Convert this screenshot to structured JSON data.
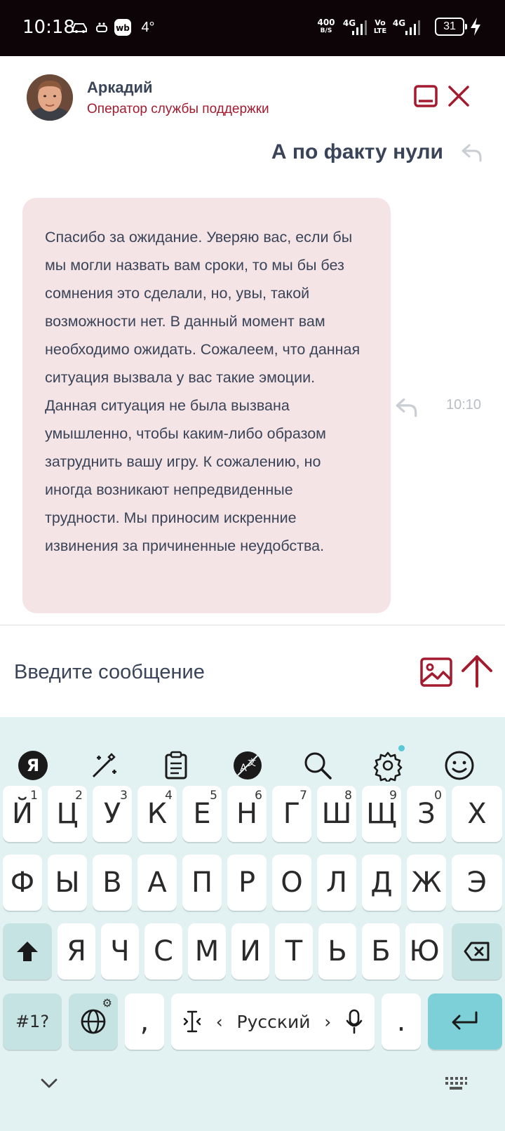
{
  "status_bar": {
    "time": "10:18",
    "temp": "4°",
    "speed_value": "400",
    "speed_unit": "B/S",
    "net1": "4G",
    "net2_top": "Vo",
    "net2_bottom": "LTE",
    "net3": "4G",
    "battery": "31"
  },
  "header": {
    "operator_name": "Аркадий",
    "operator_role": "Оператор службы поддержки"
  },
  "reply_preview": {
    "text": "А по факту нули"
  },
  "message": {
    "text": "Спасибо за ожидание. Уверяю вас, если бы мы могли назвать вам сроки, то мы бы без сомнения это сделали, но, увы, такой возможности нет. В данный момент вам необходимо ожидать. Сожалеем, что данная ситуация вызвала у вас такие эмоции. Данная ситуация не была вызвана умышленно, чтобы каким-либо образом затруднить вашу игру. К сожалению, но иногда возникают непредвиденные трудности. Мы приносим искренние извинения за причиненные неудобства.",
    "time": "10:10"
  },
  "input": {
    "placeholder": "Введите сообщение"
  },
  "keyboard": {
    "toolbar": [
      "yandex-icon",
      "magic-wand-icon",
      "clipboard-icon",
      "translate-icon",
      "search-icon",
      "gear-icon",
      "emoji-icon"
    ],
    "row1": [
      {
        "label": "Й",
        "hint": "1"
      },
      {
        "label": "Ц",
        "hint": "2"
      },
      {
        "label": "У",
        "hint": "3"
      },
      {
        "label": "К",
        "hint": "4"
      },
      {
        "label": "Е",
        "hint": "5"
      },
      {
        "label": "Н",
        "hint": "6"
      },
      {
        "label": "Г",
        "hint": "7"
      },
      {
        "label": "Ш",
        "hint": "8"
      },
      {
        "label": "Щ",
        "hint": "9"
      },
      {
        "label": "З",
        "hint": "0"
      },
      {
        "label": "Х",
        "hint": ""
      }
    ],
    "row2": [
      "Ф",
      "Ы",
      "В",
      "А",
      "П",
      "Р",
      "О",
      "Л",
      "Д",
      "Ж",
      "Э"
    ],
    "row3": [
      "Я",
      "Ч",
      "С",
      "М",
      "И",
      "Т",
      "Ь",
      "Б",
      "Ю"
    ],
    "symbols_label": "#1?",
    "comma": ",",
    "period": ".",
    "language": "Русский",
    "lang_prev": "‹",
    "lang_next": "›"
  },
  "colors": {
    "accent": "#a41a2e",
    "bubble": "#f5e4e5",
    "text": "#3a4458",
    "keyboard_bg": "#e2f1f1",
    "enter_key": "#7dd0d7"
  }
}
